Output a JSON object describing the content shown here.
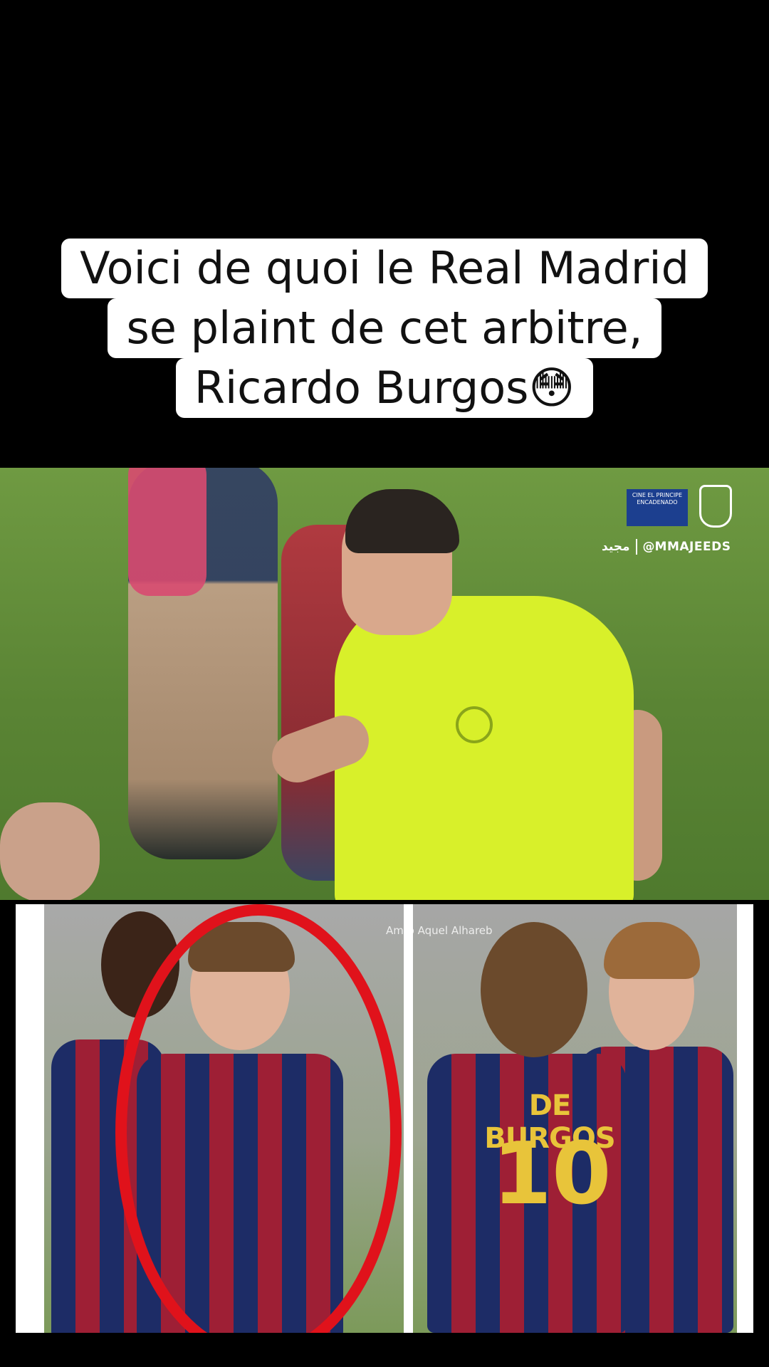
{
  "caption": {
    "line1": "Voici de quoi le Real Madrid",
    "line2": "se plaint de cet arbitre,",
    "line3": "Ricardo Burgos😳"
  },
  "video": {
    "broadcast_logo": "CINE EL PRINCIPE ENCADENADO",
    "handle": "@MMAJEEDS",
    "arabic_mark": "مجيد"
  },
  "collage": {
    "jersey_name": "DE BURGOS",
    "jersey_number": "10",
    "watermark": "Amro Aquel Alhareb"
  }
}
